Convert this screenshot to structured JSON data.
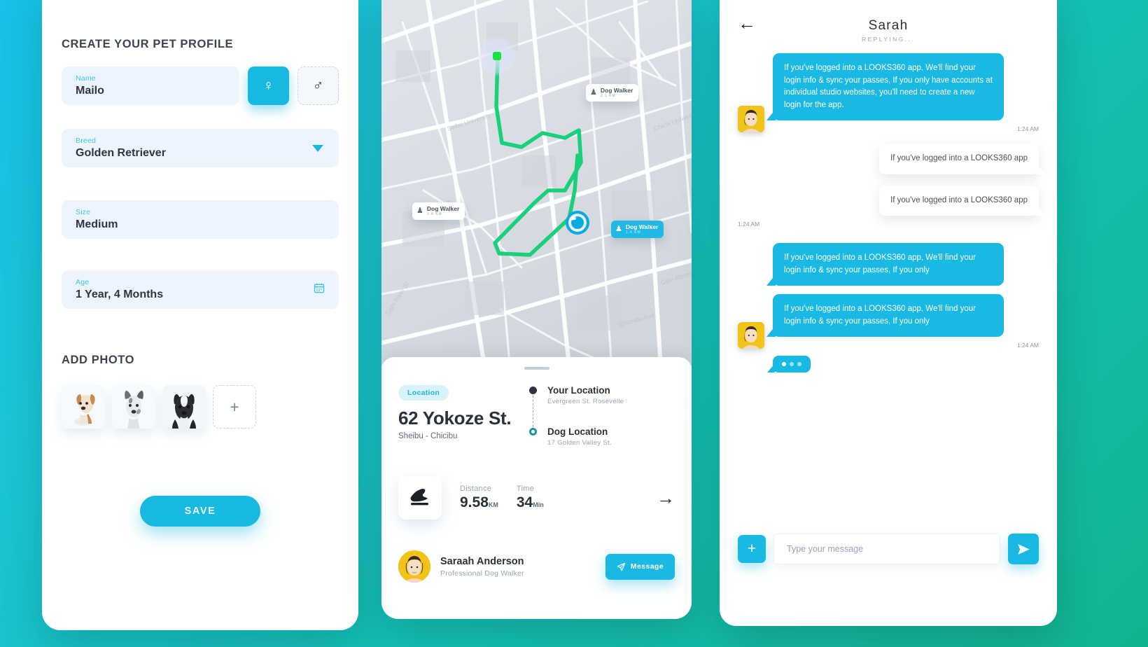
{
  "theme": {
    "bg_gradient_from": "#17c1e8",
    "bg_gradient_to": "#12b48f",
    "accent": "#1ab9e4",
    "field_bg": "#eef4fd",
    "label_color": "#3fc7d8"
  },
  "profile": {
    "title": "CREATE YOUR PET PROFILE",
    "fields": [
      {
        "label": "Name",
        "value": "Mailo"
      },
      {
        "label": "Breed",
        "value": "Golden Retriever"
      },
      {
        "label": "Size",
        "value": "Medium"
      },
      {
        "label": "Age",
        "value": "1 Year, 4 Months"
      }
    ],
    "sex": {
      "female_icon": "female-symbol",
      "female_glyph": "♀",
      "male_icon": "male-symbol",
      "male_glyph": "♂",
      "selected": "female"
    },
    "breed_dropdown_icon": "chevron-down-icon",
    "age_calendar_icon": "calendar-icon",
    "photo_title": "ADD PHOTO",
    "photos": [
      {
        "name": "beagle-puppy-photo"
      },
      {
        "name": "terrier-dog-photo"
      },
      {
        "name": "border-collie-puppy-photo"
      }
    ],
    "add_photo_glyph": "+",
    "save_label": "SAVE"
  },
  "map": {
    "pins": [
      {
        "label": "Dog Walker",
        "sub": "2.1 KM",
        "style": "white"
      },
      {
        "label": "Dog Walker",
        "sub": "3.4 KM",
        "style": "white"
      },
      {
        "label": "Dog Walker",
        "sub": "1.4 KM",
        "style": "blue"
      }
    ],
    "user_marker_icon": "current-location-dot",
    "dog_marker_icon": "dog-marker-icon",
    "sheet": {
      "badge": "Location",
      "address": "62 Yokoze St.",
      "address_sub": "Sheibu - Chicibu",
      "legend": [
        {
          "title": "Your Location",
          "sub": "Evergreen St. Rosevelle",
          "marker": "filled"
        },
        {
          "title": "Dog Location",
          "sub": "17 Golden Valley St.",
          "marker": "ring"
        }
      ],
      "stats": [
        {
          "key": "Distance",
          "value": "9.58",
          "unit": "KM"
        },
        {
          "key": "Time",
          "value": "34",
          "unit": "Min"
        }
      ],
      "shoe_icon": "walking-shoe-icon",
      "next_arrow_glyph": "→",
      "walker": {
        "name": "Saraah Anderson",
        "role": "Professional Dog Walker",
        "message_label": "Message",
        "message_icon": "paper-plane-icon"
      }
    }
  },
  "chat": {
    "back_icon": "back-arrow-icon",
    "contact": "Sarah",
    "status": "REPLYING...",
    "messages": [
      {
        "side": "out",
        "text": "If you've logged into a LOOKS360 app, We'll find your login info & sync your passes, If you only have accounts at individual studio websites, you'll need to create a new login for the app.",
        "time": "1:24 AM",
        "avatar": true
      },
      {
        "side": "in",
        "text": "If you've logged into a LOOKS360 app",
        "time": ""
      },
      {
        "side": "in",
        "text": "If you've logged into a LOOKS360 app",
        "time": "1:24 AM"
      },
      {
        "side": "out",
        "text": "If you've logged into a LOOKS360 app, We'll find your login info & sync your passes, If you only",
        "time": "",
        "avatar": false
      },
      {
        "side": "out",
        "text": "If you've logged into a LOOKS360 app, We'll find your login info & sync your passes, If you only",
        "time": "1:24 AM",
        "avatar": true
      }
    ],
    "typing_indicator": "typing-dots",
    "composer": {
      "attach_glyph": "+",
      "placeholder": "Type your message",
      "value": "",
      "send_icon": "send-icon"
    }
  }
}
